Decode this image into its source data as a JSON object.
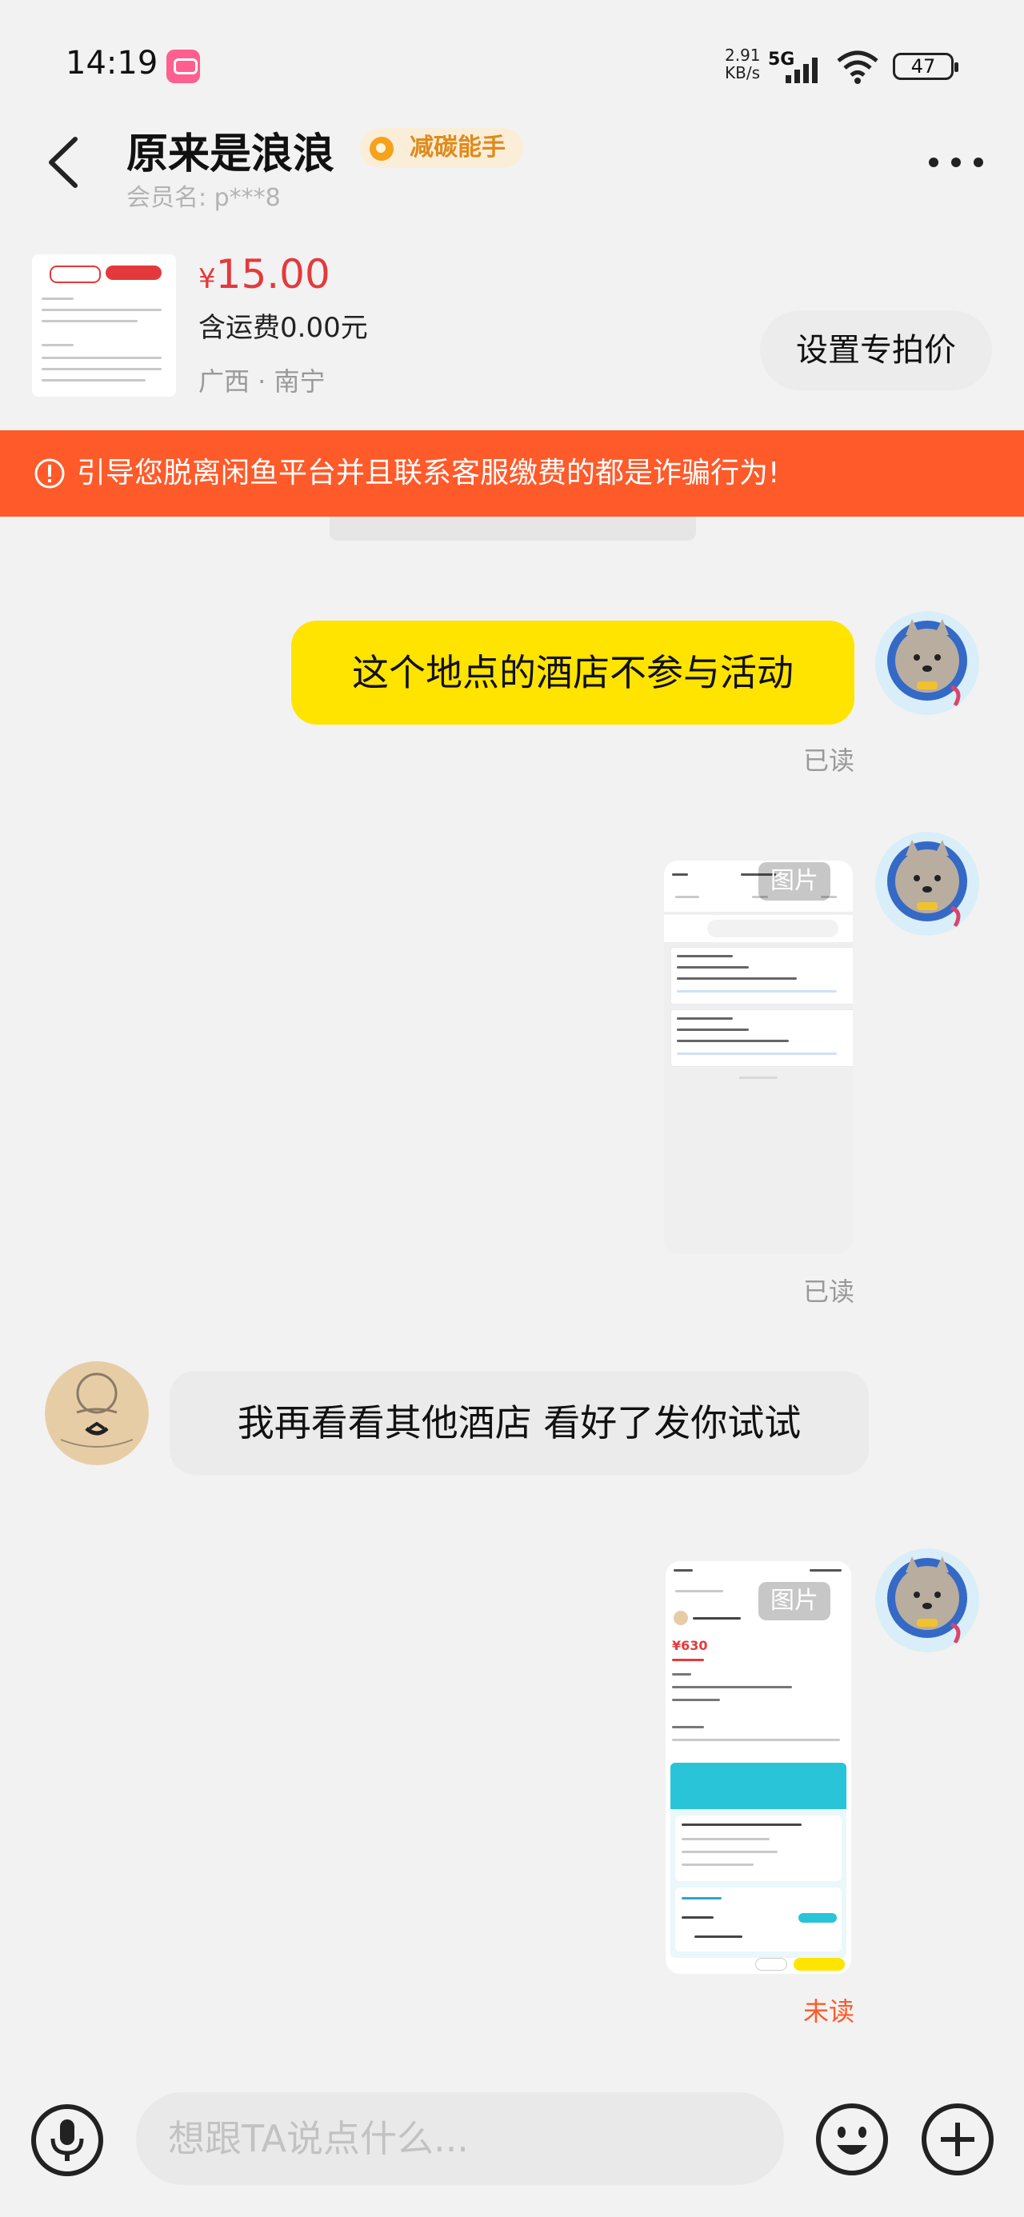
{
  "status": {
    "time": "14:19",
    "speed": "2.91\nKB/s",
    "network": "5G",
    "battery": "47"
  },
  "header": {
    "title": "原来是浪浪",
    "badge": "减碳能手",
    "member_label": "会员名: p***8"
  },
  "product": {
    "price_symbol": "¥",
    "price": "15.00",
    "shipping": "含运费0.00元",
    "location": "广西 · 南宁",
    "set_price_button": "设置专拍价"
  },
  "warning": {
    "text": "引导您脱离闲鱼平台并且联系客服缴费的都是诈骗行为!"
  },
  "messages": [
    {
      "from": "me",
      "type": "text",
      "text": "这个地点的酒店不参与活动",
      "status": "已读"
    },
    {
      "from": "me",
      "type": "image",
      "tag": "图片",
      "status": "已读"
    },
    {
      "from": "other",
      "type": "text",
      "text": "我再看看其他酒店 看好了发你试试"
    },
    {
      "from": "me",
      "type": "image",
      "tag": "图片",
      "status": "未读"
    }
  ],
  "input": {
    "placeholder": "想跟TA说点什么..."
  },
  "colors": {
    "accent_yellow": "#ffe400",
    "warning_orange": "#fe5a2a",
    "price_red": "#e4393c"
  }
}
